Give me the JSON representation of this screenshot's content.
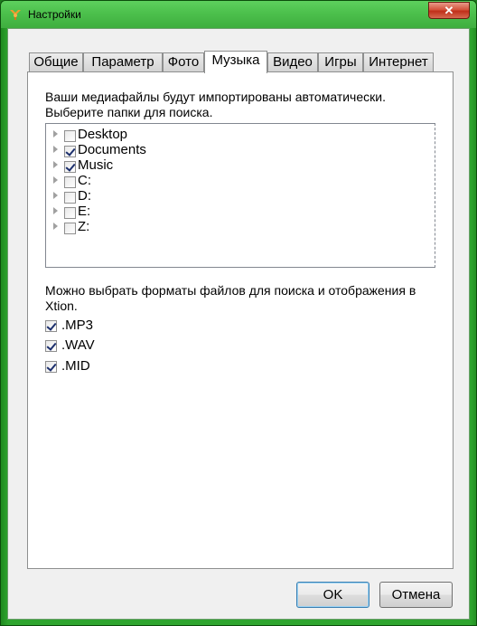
{
  "window": {
    "title": "Настройки",
    "close_label": "✕"
  },
  "tabs": [
    {
      "label": "Общие"
    },
    {
      "label": "Параметр"
    },
    {
      "label": "Фото"
    },
    {
      "label": "Музыка",
      "active": true
    },
    {
      "label": "Видео"
    },
    {
      "label": "Игры"
    },
    {
      "label": "Интернет"
    }
  ],
  "media": {
    "line1": "Ваши медиафайлы будут импортированы автоматически.",
    "line2": "Выберите папки для поиска.",
    "folders": [
      {
        "label": "Desktop",
        "checked": false
      },
      {
        "label": "Documents",
        "checked": true
      },
      {
        "label": "Music",
        "checked": true
      },
      {
        "label": "C:",
        "checked": false
      },
      {
        "label": "D:",
        "checked": false
      },
      {
        "label": "E:",
        "checked": false
      },
      {
        "label": "Z:",
        "checked": false
      }
    ]
  },
  "formats": {
    "line1": "Можно выбрать форматы файлов для поиска и отображения в",
    "line2": "Xtion.",
    "items": [
      {
        "label": ".MP3",
        "checked": true
      },
      {
        "label": ".WAV",
        "checked": true
      },
      {
        "label": ".MID",
        "checked": true
      }
    ]
  },
  "buttons": {
    "ok": "OK",
    "cancel": "Отмена"
  },
  "colors": {
    "frame": "#2ea52e",
    "title_top": "#5ed05e",
    "close": "#c0301a",
    "default_button_border": "#3c7fb1"
  },
  "icons": {
    "app": "xtion-app-icon",
    "expander": "triangle-right-icon"
  }
}
